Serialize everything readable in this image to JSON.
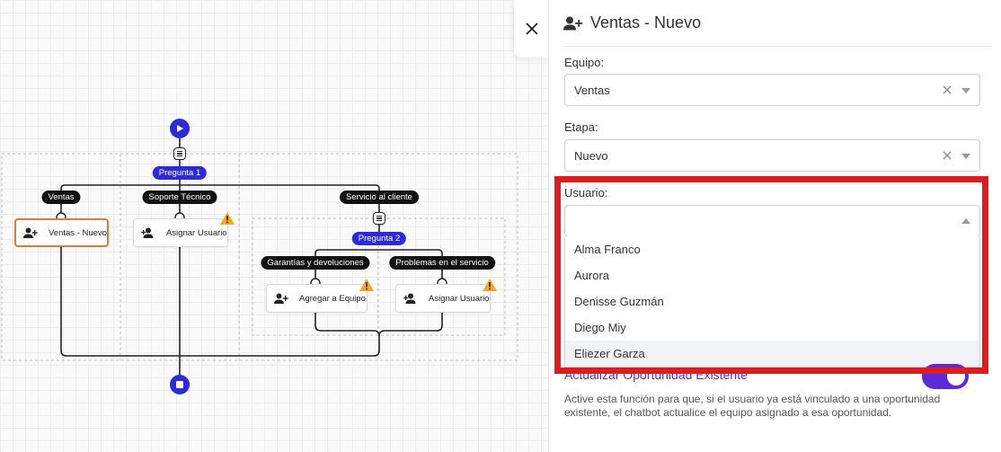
{
  "canvas": {
    "root_question": "Pregunta 1",
    "branches": [
      {
        "label": "Ventas",
        "node_label": "Ventas - Nuevo",
        "warning": false
      },
      {
        "label": "Soporte Técnico",
        "node_label": "Asignar Usuario",
        "warning": true
      },
      {
        "label": "Servicio al cliente"
      }
    ],
    "sub_question": "Pregunta 2",
    "sub_branches": [
      {
        "label": "Garantías y devoluciones",
        "node_label": "Agregar a Equipo",
        "warning": true
      },
      {
        "label": "Problemas en el servicio",
        "node_label": "Asignar Usuario",
        "warning": true
      }
    ],
    "icons": {
      "start": "play-icon",
      "end": "stop-icon",
      "question": "menu-icon",
      "assign": "user-plus-icon",
      "warning": "warning-icon"
    },
    "colors": {
      "accent": "#2d2adb",
      "active_border": "#e07a3a",
      "warning": "#f5a623"
    }
  },
  "close_button": {
    "icon": "close-icon"
  },
  "panel": {
    "title": "Ventas - Nuevo",
    "title_icon": "user-plus-icon",
    "team": {
      "label": "Equipo:",
      "value": "Ventas"
    },
    "stage": {
      "label": "Etapa:",
      "value": "Nuevo"
    },
    "user": {
      "label": "Usuario:",
      "value": "",
      "options": [
        "Alma Franco",
        "Aurora",
        "Denisse Guzmán",
        "Diego Miy",
        "Eliezer Garza"
      ]
    },
    "toggle": {
      "label": "Actualizar Oportunidad Existente",
      "on": true,
      "help": "Active esta función para que, si el usuario ya está vinculado a una oportunidad existente, el chatbot actualice el equipo asignado a esa oportunidad."
    },
    "colors": {
      "highlight": "#e01b1b",
      "toggle": "#5a2bd6"
    }
  }
}
